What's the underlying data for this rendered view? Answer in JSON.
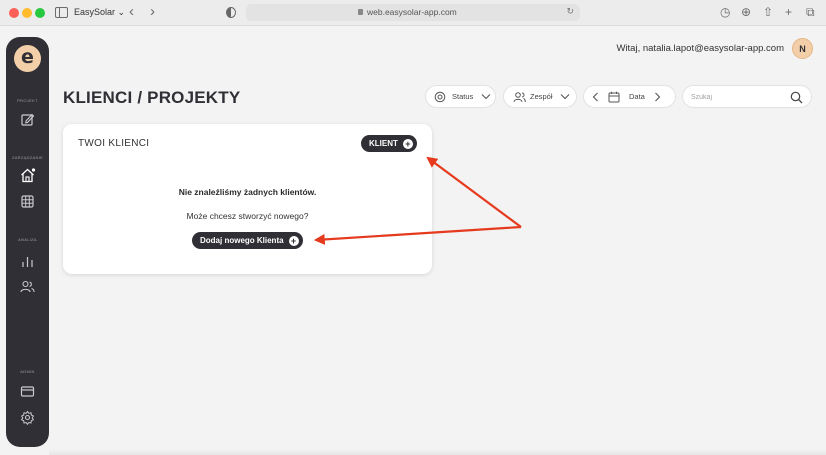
{
  "browser": {
    "tab_title": "EasySolar ⌄",
    "url": "web.easysolar-app.com",
    "back_glyph": "‹",
    "forward_glyph": "›"
  },
  "sidebar": {
    "logo_glyph": "e",
    "sections": [
      {
        "label": "PROJEKT",
        "icons": [
          "edit-icon"
        ]
      },
      {
        "label": "ZARZĄDZANIE",
        "icons": [
          "home-icon",
          "grid-icon"
        ]
      },
      {
        "label": "ANALIZA",
        "icons": [
          "chart-icon",
          "users-icon"
        ]
      },
      {
        "label": "ADMIN",
        "icons": [
          "card-icon",
          "gear-icon"
        ]
      }
    ]
  },
  "header": {
    "greeting": "Witaj, natalia.lapot@easysolar-app.com",
    "avatar_initial": "N"
  },
  "page": {
    "title": "KLIENCI / PROJEKTY"
  },
  "filters": {
    "status_label": "Status",
    "team_label": "Zespół",
    "date_label": "Data",
    "search_placeholder": "Szukaj"
  },
  "card": {
    "title": "TWOI KLIENCI",
    "client_button": "KLIENT",
    "empty_title": "Nie znaleźliśmy żadnych klientów.",
    "empty_subtitle": "Może chcesz stworzyć nowego?",
    "add_button": "Dodaj nowego Klienta",
    "plus_glyph": "+"
  },
  "colors": {
    "sidebar_bg": "#2f2f35",
    "accent_peach": "#f3cfa9",
    "annotation_arrow": "#e63a1e",
    "page_bg": "#f3f3f3"
  }
}
